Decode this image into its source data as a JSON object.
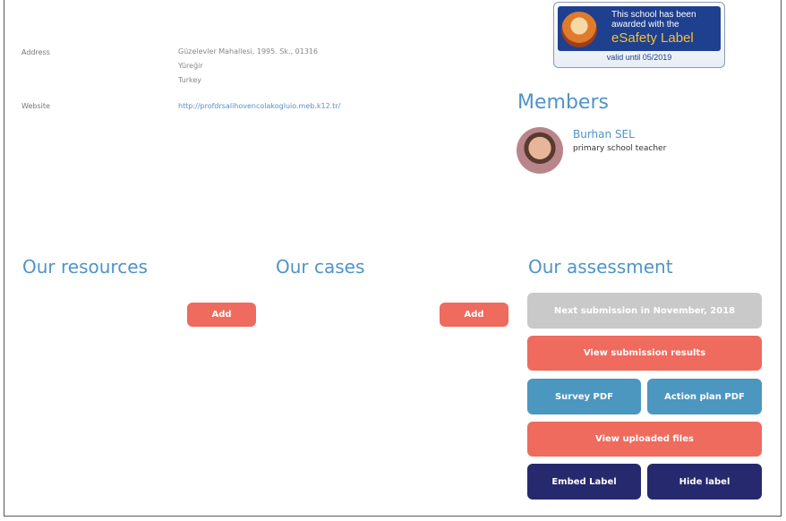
{
  "details": {
    "address_label": "Address",
    "address_lines": [
      "Güzelevler Mahallesi, 1995. Sk., 01316",
      "Yüreğir",
      "Turkey"
    ],
    "website_label": "Website",
    "website_url": "http://profdrsalihovencolakogluio.meb.k12.tr/"
  },
  "badge": {
    "line1": "This school has been",
    "line2": "awarded with the",
    "line3": "eSafety Label",
    "valid": "valid until 05/2019"
  },
  "members": {
    "heading": "Members",
    "items": [
      {
        "name": "Burhan SEL",
        "role": "primary school teacher"
      }
    ]
  },
  "resources": {
    "heading": "Our resources",
    "add_label": "Add"
  },
  "cases": {
    "heading": "Our cases",
    "add_label": "Add"
  },
  "assessment": {
    "heading": "Our assessment",
    "next_submission": "Next submission in November, 2018",
    "view_results": "View submission results",
    "survey_pdf": "Survey PDF",
    "action_plan_pdf": "Action plan PDF",
    "view_uploaded": "View uploaded files",
    "embed_label": "Embed Label",
    "hide_label": "Hide label"
  },
  "colors": {
    "heading_blue": "#4f94c7",
    "salmon": "#ee6b5e",
    "grey": "#c9c9c9",
    "steel_blue": "#4c97c0",
    "navy": "#26296e"
  }
}
